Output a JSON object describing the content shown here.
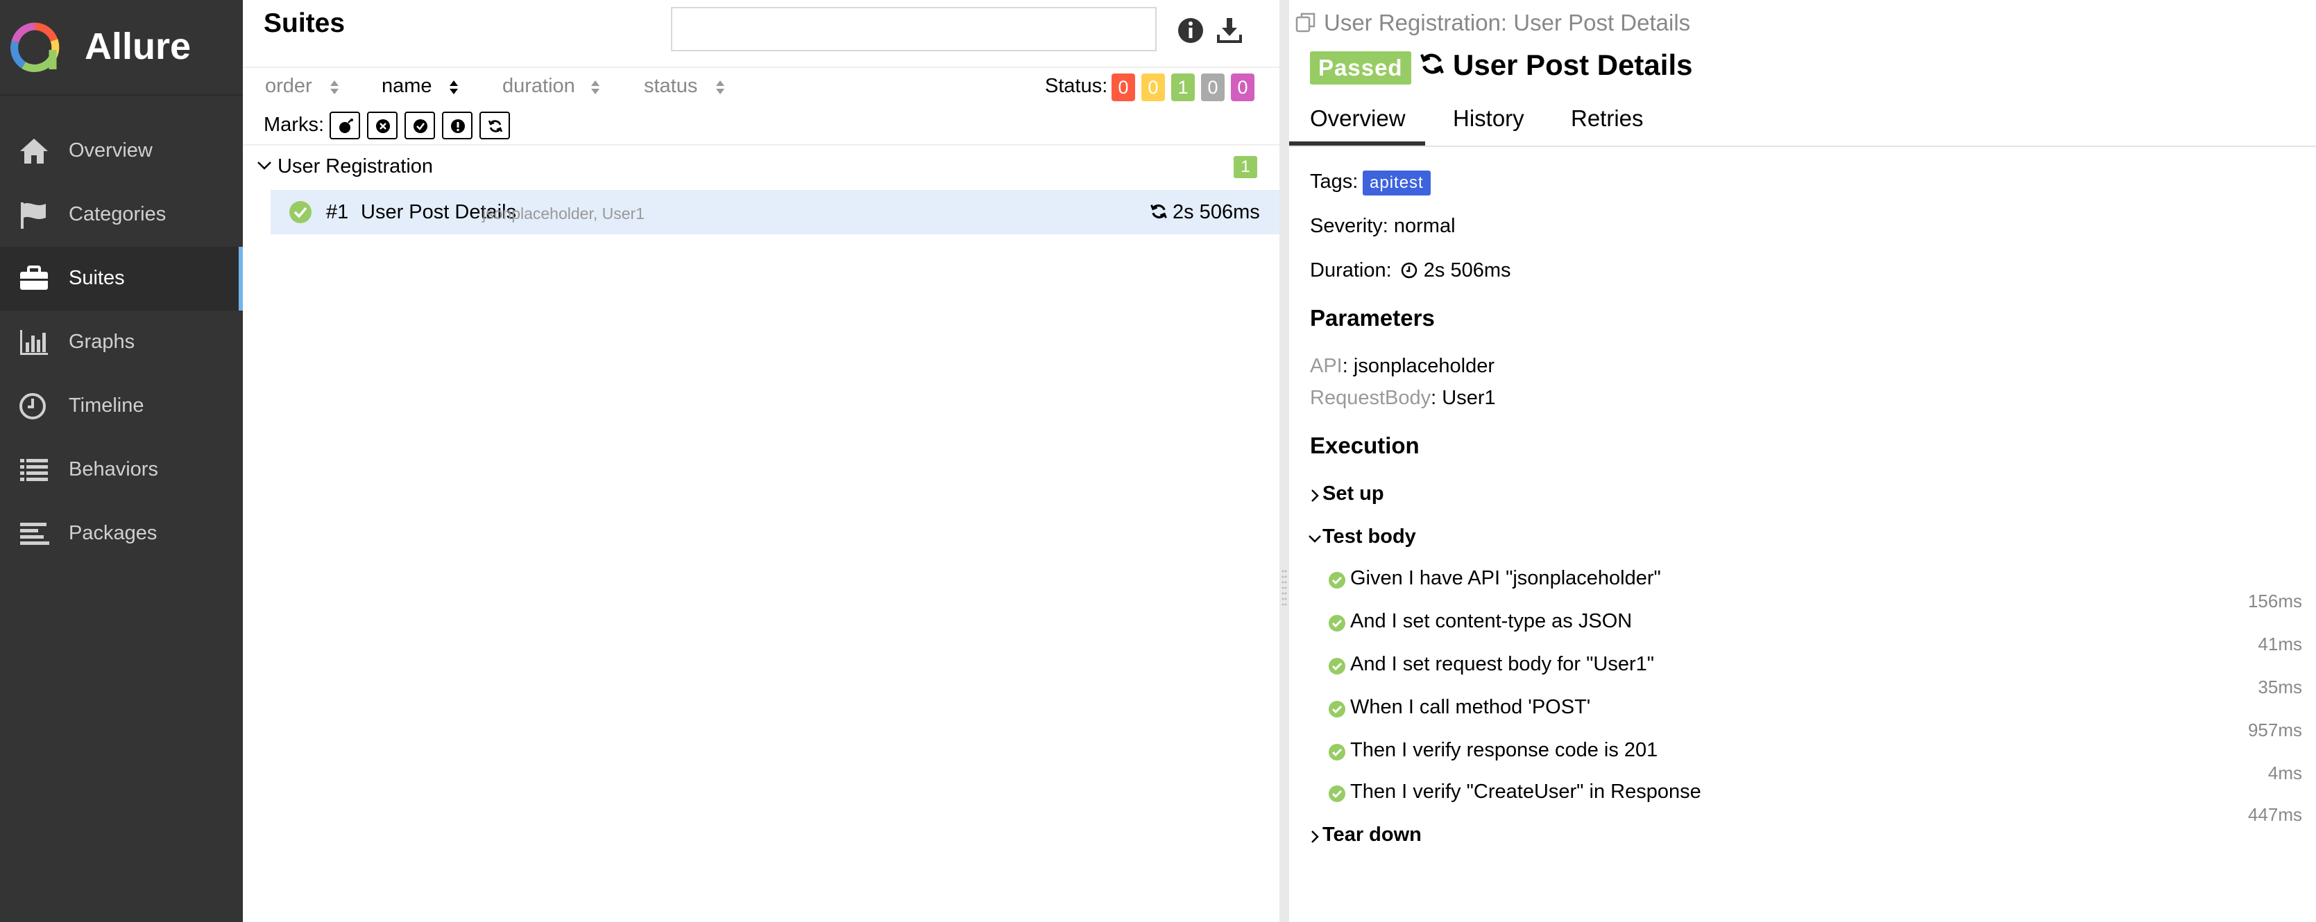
{
  "app": {
    "name": "Allure",
    "accent_color": "#74b4e8"
  },
  "sidebar": {
    "items": [
      {
        "label": "Overview",
        "icon": "home-icon",
        "active": false
      },
      {
        "label": "Categories",
        "icon": "flag-icon",
        "active": false
      },
      {
        "label": "Suites",
        "icon": "briefcase-icon",
        "active": true
      },
      {
        "label": "Graphs",
        "icon": "bar-chart-icon",
        "active": false
      },
      {
        "label": "Timeline",
        "icon": "clock-icon",
        "active": false
      },
      {
        "label": "Behaviors",
        "icon": "list-icon",
        "active": false
      },
      {
        "label": "Packages",
        "icon": "align-left-icon",
        "active": false
      }
    ]
  },
  "suites": {
    "title": "Suites",
    "search": {
      "value": "",
      "placeholder": ""
    },
    "sort_columns": [
      "order",
      "name",
      "duration",
      "status"
    ],
    "active_sort": "name",
    "status_label": "Status:",
    "status_counts": [
      {
        "value": "0",
        "color": "#fd5a3e"
      },
      {
        "value": "0",
        "color": "#ffd050"
      },
      {
        "value": "1",
        "color": "#97cc64"
      },
      {
        "value": "0",
        "color": "#aaaaaa"
      },
      {
        "value": "0",
        "color": "#d35ebe"
      }
    ],
    "marks_label": "Marks:",
    "marks": [
      "bomb-icon",
      "times-circle-icon",
      "check-circle-icon",
      "info-circle-icon",
      "refresh-icon"
    ],
    "group": {
      "name": "User Registration",
      "count": "1"
    },
    "tests": [
      {
        "num": "#1",
        "name": "User Post Details",
        "params": "jsonplaceholder, User1",
        "duration": "2s 506ms"
      }
    ]
  },
  "detail": {
    "breadcrumb": "User Registration: User Post Details",
    "status": "Passed",
    "status_color": "#97cc64",
    "title": "User Post Details",
    "tabs": [
      "Overview",
      "History",
      "Retries"
    ],
    "active_tab": "Overview",
    "tags_label": "Tags:",
    "tag": "apitest",
    "tag_color": "#3d63dd",
    "severity": "Severity: normal",
    "duration_label": "Duration:",
    "duration": "2s 506ms",
    "parameters_heading": "Parameters",
    "parameters": [
      {
        "key": "API",
        "value": "jsonplaceholder"
      },
      {
        "key": "RequestBody",
        "value": "User1"
      }
    ],
    "execution_heading": "Execution",
    "setup_label": "Set up",
    "test_body_label": "Test body",
    "teardown_label": "Tear down",
    "steps": [
      {
        "text": "Given I have API \"jsonplaceholder\"",
        "time": "156ms"
      },
      {
        "text": "And I set content-type as JSON",
        "time": "41ms"
      },
      {
        "text": "And I set request body for \"User1\"",
        "time": "35ms"
      },
      {
        "text": "When I call method 'POST'",
        "time": "957ms"
      },
      {
        "text": "Then I verify response code is 201",
        "time": "4ms"
      },
      {
        "text": "Then I verify \"CreateUser\" in Response",
        "time": "447ms"
      }
    ]
  }
}
